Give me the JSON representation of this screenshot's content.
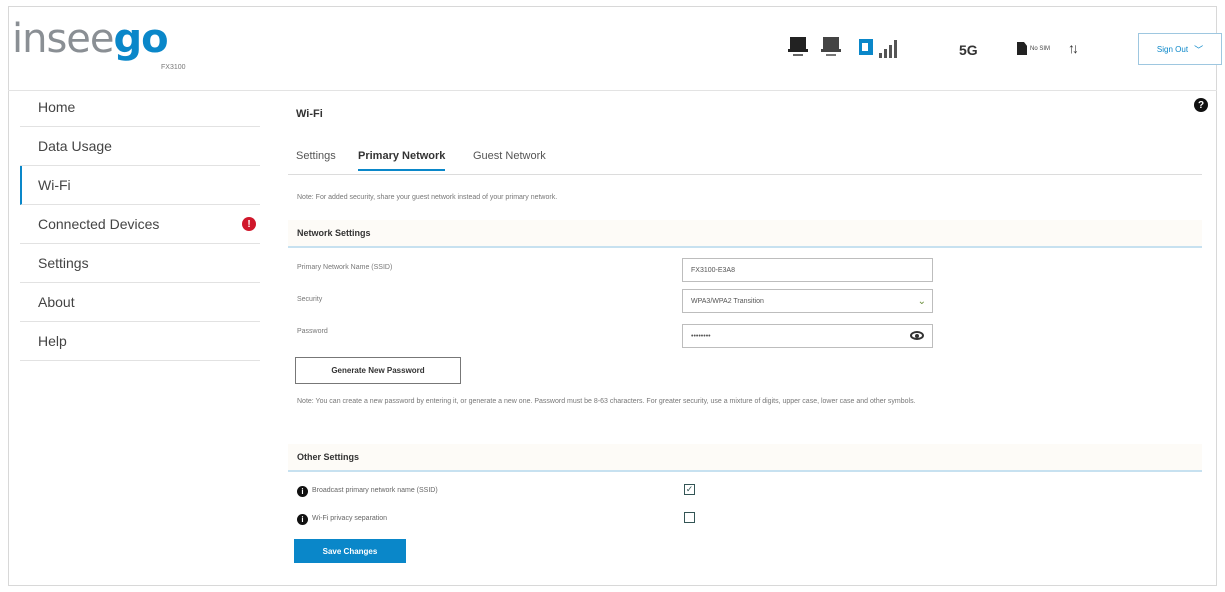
{
  "brand": {
    "name_part1": "insee",
    "name_part2": "go",
    "model": "FX3100",
    "accent": "#0a87c9"
  },
  "header": {
    "status_icons": [
      "lan-port-icon",
      "lan-port-icon",
      "signal-strength-icon"
    ],
    "network_type": "5G",
    "sim_status": "No SIM",
    "data_arrows": "↑↓",
    "sign_out_label": "Sign Out"
  },
  "sidebar": {
    "items": [
      {
        "label": "Home"
      },
      {
        "label": "Data Usage"
      },
      {
        "label": "Wi-Fi",
        "active": true
      },
      {
        "label": "Connected Devices",
        "badge": "!"
      },
      {
        "label": "Settings"
      },
      {
        "label": "About"
      },
      {
        "label": "Help"
      }
    ]
  },
  "main": {
    "title": "Wi-Fi",
    "help_icon": "?",
    "tabs": [
      {
        "label": "Settings"
      },
      {
        "label": "Primary Network",
        "active": true
      },
      {
        "label": "Guest Network"
      }
    ],
    "note1": "Note: For added security, share your guest network instead of your primary network.",
    "network_settings": {
      "heading": "Network Settings",
      "ssid_label": "Primary Network Name (SSID)",
      "ssid_value": "FX3100-E3A8",
      "security_label": "Security",
      "security_value": "WPA3/WPA2 Transition",
      "password_label": "Password",
      "password_value": "••••••••",
      "generate_button": "Generate New Password",
      "note2": "Note: You can create a new password by entering it, or generate a new one. Password must be 8-63 characters. For greater security, use a mixture of digits, upper case, lower case and other symbols."
    },
    "other_settings": {
      "heading": "Other Settings",
      "broadcast_label": "Broadcast primary network name (SSID)",
      "broadcast_checked": true,
      "isolation_label": "Wi-Fi privacy separation",
      "isolation_checked": false
    },
    "save_button": "Save Changes"
  }
}
